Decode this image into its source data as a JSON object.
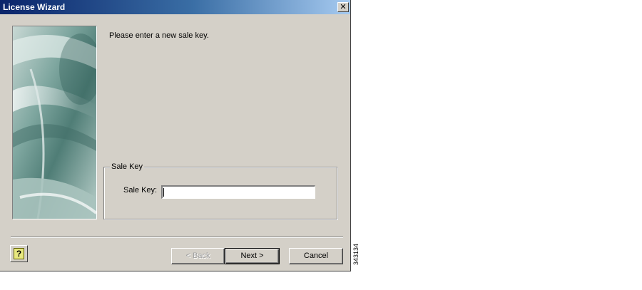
{
  "window": {
    "title": "License Wizard",
    "close_label": "✕"
  },
  "content": {
    "prompt": "Please enter a new sale key."
  },
  "sale_key_group": {
    "legend": "Sale Key",
    "label": "Sale Key:",
    "value": ""
  },
  "buttons": {
    "help_label": "?",
    "back_label": "< Back",
    "next_label": "Next >",
    "cancel_label": "Cancel"
  },
  "figure_id": "343134",
  "colors": {
    "titlebar_start": "#0a246a",
    "titlebar_end": "#a6caf0",
    "dialog_face": "#d4d0c8",
    "graphic_teal": "#8fb4ae"
  },
  "icons": {
    "help": "help-icon",
    "close": "close-icon",
    "wizard_graphic": "wizard-graphic"
  }
}
